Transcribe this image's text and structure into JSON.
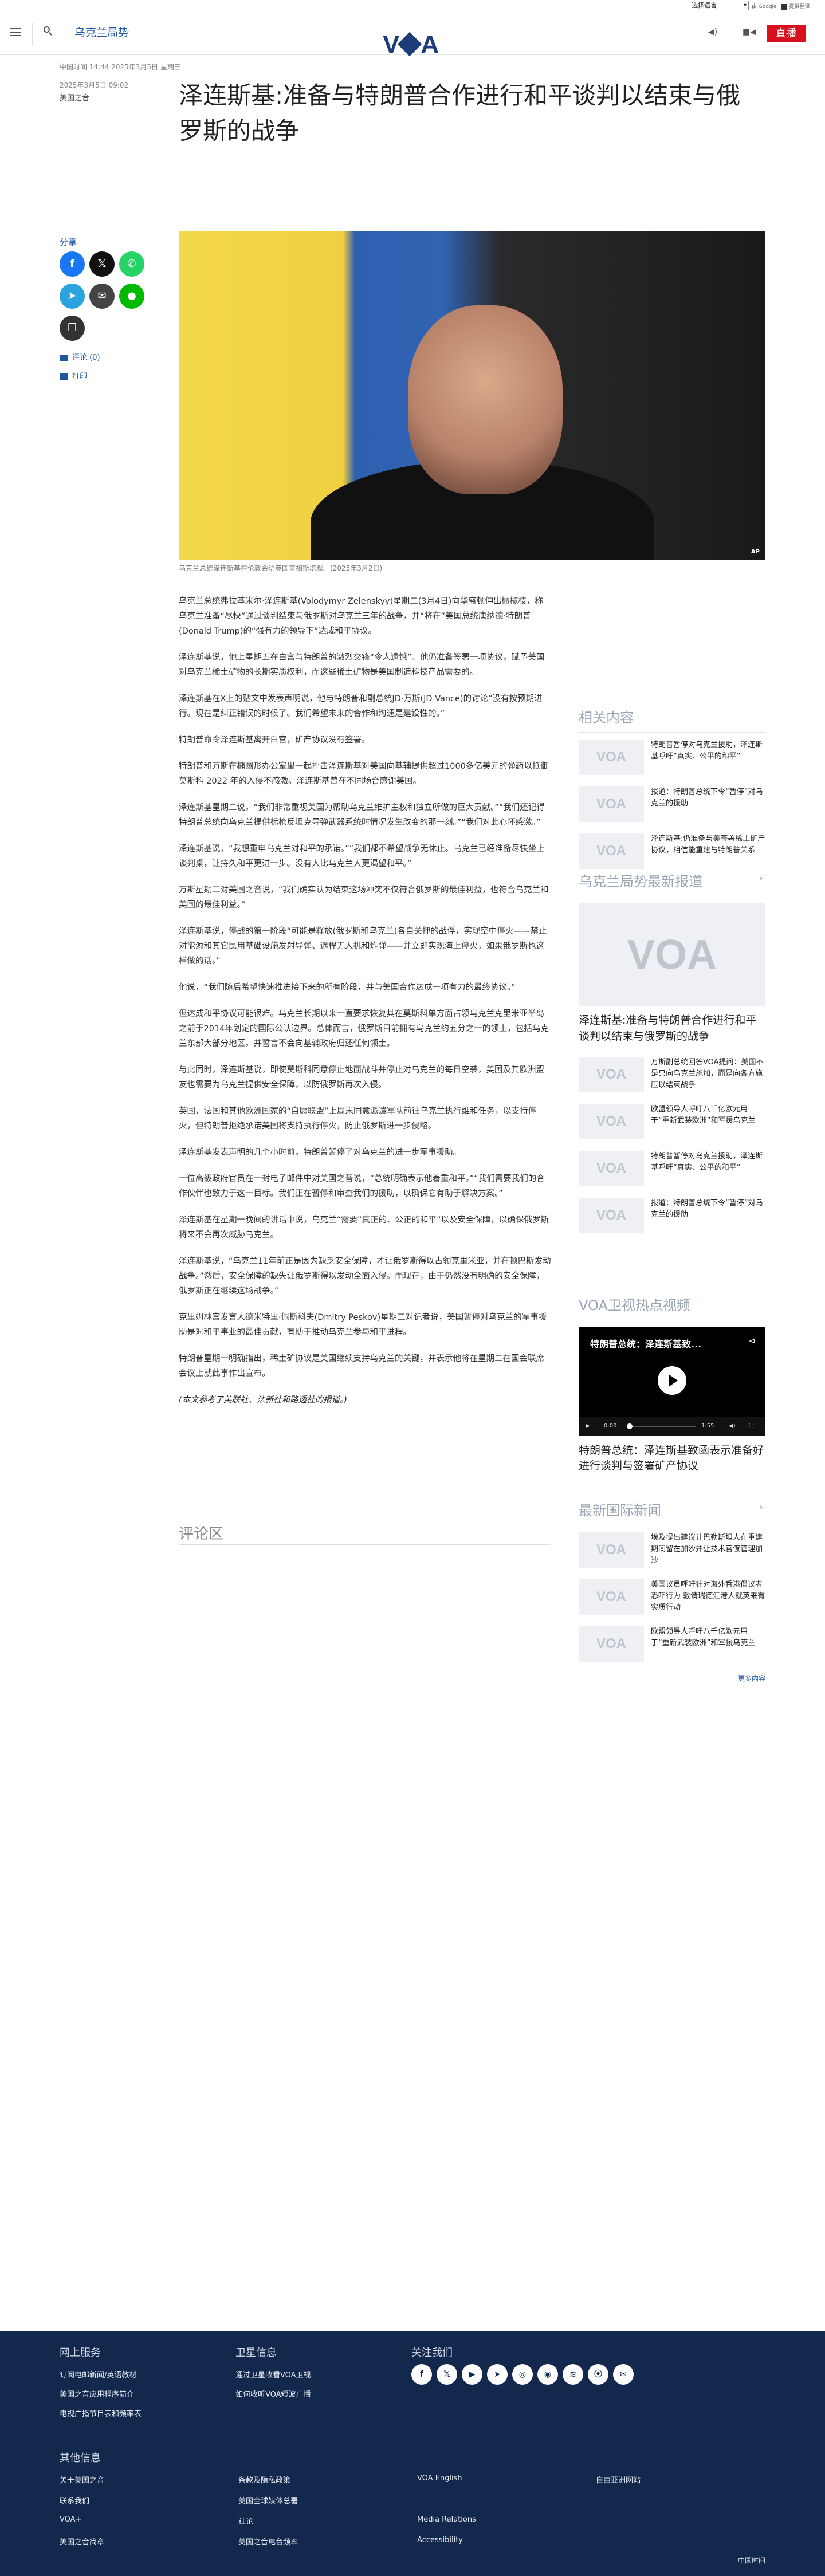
{
  "translate": {
    "select_label": "选择语言",
    "powered_by": "由 Google",
    "translate_label": "提供翻译"
  },
  "header": {
    "section_label": "乌克兰局势",
    "logo_text_left": "V",
    "logo_text_right": "A",
    "audio_icon": "speaker-icon",
    "video_icon": "video-camera-icon",
    "live_label": "直播"
  },
  "article": {
    "dateline": "中国时间 14:44 2025年3月5日 星期三",
    "published": "2025年3月5日 09:02",
    "author": "美国之音",
    "title": "泽连斯基:准备与特朗普合作进行和平谈判以结束与俄罗斯的战争",
    "hero_badge": "AP",
    "caption": "乌克兰总统泽连斯基在伦敦会晤英国首相斯塔默。(2025年3月2日)",
    "paragraphs": [
      "乌克兰总统弗拉基米尔·泽连斯基(Volodymyr Zelenskyy)星期二(3月4日)向华盛顿伸出橄榄枝，称乌克兰准备“尽快”通过谈判结束与俄罗斯对乌克兰三年的战争，并“将在”美国总统唐纳德·特朗普(Donald Trump)的“强有力的领导下”达成和平协议。",
      "泽连斯基说，他上星期五在白宫与特朗普的激烈交锋“令人遗憾”。他仍准备签署一项协议，赋予美国对乌克兰稀土矿物的长期实质权利，而这些稀土矿物是美国制造科技产品需要的。",
      "泽连斯基在X上的贴文中发表声明说，他与特朗普和副总统JD·万斯(JD Vance)的讨论“没有按预期进行。现在是纠正错误的时候了。我们希望未来的合作和沟通是建设性的。”",
      "特朗普命令泽连斯基离开白宫，矿产协议没有签署。",
      "特朗普和万斯在椭圆形办公室里一起抨击泽连斯基对美国向基辅提供超过1000多亿美元的弹药以抵御莫斯科 2022 年的入侵不感激。泽连斯基曾在不同场合感谢美国。",
      "泽连斯基星期二说，“我们非常重视美国为帮助乌克兰维护主权和独立所做的巨大贡献。”“我们还记得特朗普总统向乌克兰提供标枪反坦克导弹武器系统时情况发生改变的那一刻。”“我们对此心怀感激。”",
      "泽连斯基说，“我想重申乌克兰对和平的承诺。”“我们都不希望战争无休止。乌克兰已经准备尽快坐上谈判桌，让持久和平更进一步。没有人比乌克兰人更渴望和平。”",
      "万斯星期二对美国之音说，“我们确实认为结束这场冲突不仅符合俄罗斯的最佳利益，也符合乌克兰和美国的最佳利益。”",
      "泽连斯基说，停战的第一阶段“可能是释放(俄罗斯和乌克兰)各自关押的战俘，实现空中停火——禁止对能源和其它民用基础设施发射导弹、远程无人机和炸弹——并立即实现海上停火，如果俄罗斯也这样做的话。”",
      "他说，“我们随后希望快速推进接下来的所有阶段，并与美国合作达成一项有力的最终协议。”",
      "但达成和平协议可能很难。乌克兰长期以来一直要求恢复其在莫斯科单方面占领乌克兰克里米亚半岛之前于2014年划定的国际公认边界。总体而言，俄罗斯目前拥有乌克兰约五分之一的领土，包括乌克兰东部大部分地区，并誓言不会向基辅政府归还任何领土。",
      "与此同时，泽连斯基说，即使莫斯科同意停止地面战斗并停止对乌克兰的每日空袭，美国及其欧洲盟友也需要为乌克兰提供安全保障，以防俄罗斯再次入侵。",
      "英国、法国和其他欧洲国家的“自愿联盟”上周末同意派遣军队前往乌克兰执行维和任务，以支持停火，但特朗普拒绝承诺美国将支持执行停火，防止俄罗斯进一步侵略。",
      "泽连斯基发表声明的几个小时前，特朗普暂停了对乌克兰的进一步军事援助。",
      "一位高级政府官员在一封电子邮件中对美国之音说，“总统明确表示他着重和平。”“我们需要我们的合作伙伴也致力于这一目标。我们正在暂停和审查我们的援助，以确保它有助于解决方案。”",
      "泽连斯基在星期一晚间的讲话中说，乌克兰“需要”真正的、公正的和平”以及安全保障，以确保俄罗斯将来不会再次威胁乌克兰。",
      "泽连斯基说，“乌克兰11年前正是因为缺乏安全保障，才让俄罗斯得以占领克里米亚，并在顿巴斯发动战争。”然后，安全保障的缺失让俄罗斯得以发动全面入侵。而现在，由于仍然没有明确的安全保障，俄罗斯正在继续这场战争。”",
      "克里姆林宫发言人德米特里·佩斯科夫(Dmitry Peskov)星期二对记者说，美国暂停对乌克兰的军事援助是对和平事业的最佳贡献，有助于推动乌克兰参与和平进程。",
      "特朗普星期一明确指出，稀土矿协议是美国继续支持乌克兰的关键，并表示他将在星期二在国会联席会议上就此事作出宣布。"
    ],
    "note": "(本文参考了美联社、法新社和路透社的报道。)",
    "comments_title": "评论区"
  },
  "share": {
    "label": "分享",
    "buttons": [
      "facebook-icon",
      "x-icon",
      "whatsapp-icon",
      "telegram-icon",
      "mail-icon",
      "line-icon",
      "copy-link-icon"
    ],
    "comments_link": "评论 (0)",
    "print_link": "打印"
  },
  "sidebar": {
    "related_title": "相关内容",
    "related": [
      "特朗普暂停对乌克兰援助，泽连斯基呼吁“真实、公平的和平”",
      "报道：特朗普总统下令“暂停”对乌克兰的援助",
      "泽连斯基:仍准备与美签署稀土矿产协议，相信能重建与特朗普关系"
    ],
    "latest_title": "乌克兰局势最新报道",
    "latest_lead": "泽连斯基:准备与特朗普合作进行和平谈判以结束与俄罗斯的战争",
    "latest": [
      "万斯副总统回答VOA提问：美国不是只向乌克兰施加，而是向各方施压以结束战争",
      "欧盟领导人呼吁八千亿欧元用于“重新武装欧洲”和军援乌克兰",
      "特朗普暂停对乌克兰援助，泽连斯基呼吁“真实、公平的和平”",
      "报道：特朗普总统下令“暂停”对乌克兰的援助"
    ],
    "video_title": "VOA卫视热点视频",
    "video_overlay": "特朗普总统：泽连斯基致...",
    "video_time_start": "0:00",
    "video_time_end": "1:55",
    "video_caption": "特朗普总统：泽连斯基致函表示准备好进行谈判与签署矿产协议",
    "world_title": "最新国际新闻",
    "world": [
      "埃及提出建议让巴勒斯坦人在重建期间留在加沙并让技术官僚管理加沙",
      "美国议员呼吁针对海外香港倡议者恐吓行为 敦请瑞德汇港人就英来有实质行动",
      "欧盟领导人呼吁八千亿欧元用于“重新武装欧洲”和军援乌克兰"
    ],
    "more_label": "更多内容"
  },
  "footer": {
    "online_title": "网上服务",
    "online_links": [
      "订阅电邮新闻/英语教材",
      "美国之音应用程序简介",
      "电视广播节目表和频率表"
    ],
    "satellite_title": "卫星信息",
    "satellite_links": [
      "通过卫星收看VOA卫视",
      "如何收听VOA短波广播"
    ],
    "follow_title": "关注我们",
    "social_icons": [
      "facebook-icon",
      "x-icon",
      "youtube-icon",
      "telegram-icon",
      "instagram-icon",
      "podcast-icon",
      "rss-icon",
      "podcast2-icon",
      "mail-icon"
    ],
    "other_title": "其他信息",
    "other_links_col1": [
      "关于美国之音",
      "联系我们",
      "VOA+",
      "美国之音简章"
    ],
    "other_links_col2": [
      "条款及隐私政策",
      "美国全球媒体总署",
      "社论",
      "美国之音电台频率"
    ],
    "other_links_col3": [
      "VOA English",
      "",
      "Media Relations",
      "Accessibility"
    ],
    "other_links_col4": [
      "自由亚洲网站"
    ],
    "timezone": "中国时间"
  }
}
